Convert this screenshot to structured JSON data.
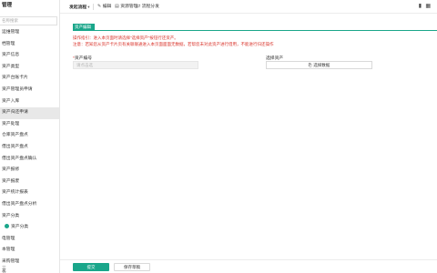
{
  "sidebar": {
    "title": "管理",
    "search_placeholder": "名称搜索",
    "items": [
      {
        "label": "运维管理",
        "active": false
      },
      {
        "label": "档管理",
        "active": false
      },
      {
        "label": "资产信息",
        "active": false
      },
      {
        "label": "资产类型",
        "active": false
      },
      {
        "label": "资产台账卡片",
        "active": false
      },
      {
        "label": "资产管理员申请",
        "active": false
      },
      {
        "label": "资产入库",
        "active": false
      },
      {
        "label": "资产归还申请",
        "active": true
      },
      {
        "label": "资产处理",
        "active": false
      },
      {
        "label": "仓库资产盘点",
        "active": false
      },
      {
        "label": "借出资产盘点",
        "active": false
      },
      {
        "label": "借出资产盘点确认",
        "active": false
      },
      {
        "label": "资产报修",
        "active": false
      },
      {
        "label": "资产报废",
        "active": false
      },
      {
        "label": "资产统计报表",
        "active": false
      },
      {
        "label": "借出资产盘点分析",
        "active": false
      },
      {
        "label": "资产分类",
        "active": false
      },
      {
        "label": "资产分类",
        "active": false,
        "sub": true,
        "dot": true
      },
      {
        "label": "电管理",
        "active": false
      },
      {
        "label": "本管理",
        "active": false
      },
      {
        "label": "采购管理",
        "active": false
      },
      {
        "label": "务",
        "active": false
      }
    ],
    "footer": "三"
  },
  "topbar": {
    "module": "发起流程",
    "module_chevron": "▾",
    "edit": "编辑",
    "resources": "资源管理",
    "flow": "流程分发",
    "edit_icon": "pencil-icon",
    "res_icon": "folder-icon",
    "flow_icon": "flow-icon",
    "right_icon_1": "▮",
    "right_icon_2": "▦"
  },
  "form": {
    "header_tab": "资产编辑",
    "guide_line1": "操作指引：进入本页面时请选择\"选择资产\"按钮行还资产。",
    "guide_line2": "注意：若知您从资产卡片页有关联联通进入本页面面面无数据，若帮您未对此资产进行借用，不能进行归还操作",
    "code_label": "资产编号",
    "code_required": "*",
    "code_placeholder": "请点击选",
    "select_label": "选择资产",
    "select_button": "选择数据",
    "select_icon": "⎘"
  },
  "footer": {
    "submit": "提交",
    "draft": "保存草稿"
  },
  "colors": {
    "accent": "#1aa68a",
    "warning": "#d9342b"
  }
}
